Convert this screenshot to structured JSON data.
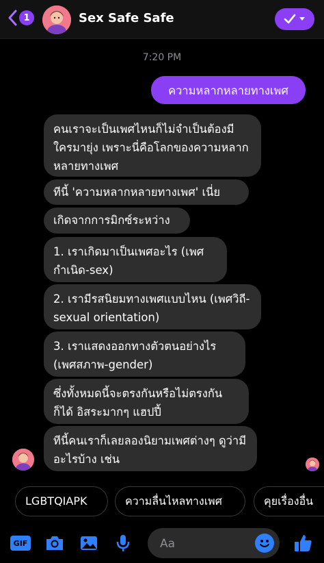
{
  "header": {
    "unread_count": "1",
    "title": "Sex Safe Safe"
  },
  "timestamp": "7:20 PM",
  "messages": {
    "outgoing": "ความหลากหลายทางเพศ",
    "incoming": [
      "คนเราจะเป็นเพศไหนก็ไม่จำเป็นต้องมีใครมายุ่ง เพราะนี่คือโลกของความหลากหลายทางเพศ",
      "ทีนี้ 'ความหลากหลายทางเพศ' เนี่ย",
      "เกิดจากการมิกซ์ระหว่าง",
      "1. เราเกิดมาเป็นเพศอะไร (เพศกำเนิด-sex)",
      "2. เรามีรสนิยมทางเพศแบบไหน (เพศวิถี-sexual orientation)",
      "3. เราแสดงออกทางตัวตนอย่างไร (เพศสภาพ-gender)",
      "ซึ่งทั้งหมดนี้จะตรงกันหรือไม่ตรงกันก็ได้ อิสระมากๆ แฮปปี้",
      "ทีนี้คนเราก็เลยลองนิยามเพศต่างๆ ดูว่ามีอะไรบ้าง เช่น"
    ]
  },
  "quick_replies": [
    "LGBTQIAPK",
    "ความลื่นไหลทางเพศ",
    "คุยเรื่องอื่น"
  ],
  "composer": {
    "placeholder": "Aa",
    "gif_label": "GIF"
  },
  "colors": {
    "accent": "#8b3ff5",
    "bubble_incoming": "#2e2e2e",
    "icon_blue": "#2f80ff",
    "background": "#000000"
  },
  "icons": [
    "back-chevron-icon",
    "checkmark-icon",
    "chevron-down-icon",
    "gif-icon",
    "camera-icon",
    "gallery-icon",
    "microphone-icon",
    "emoji-icon",
    "thumbs-up-icon"
  ]
}
